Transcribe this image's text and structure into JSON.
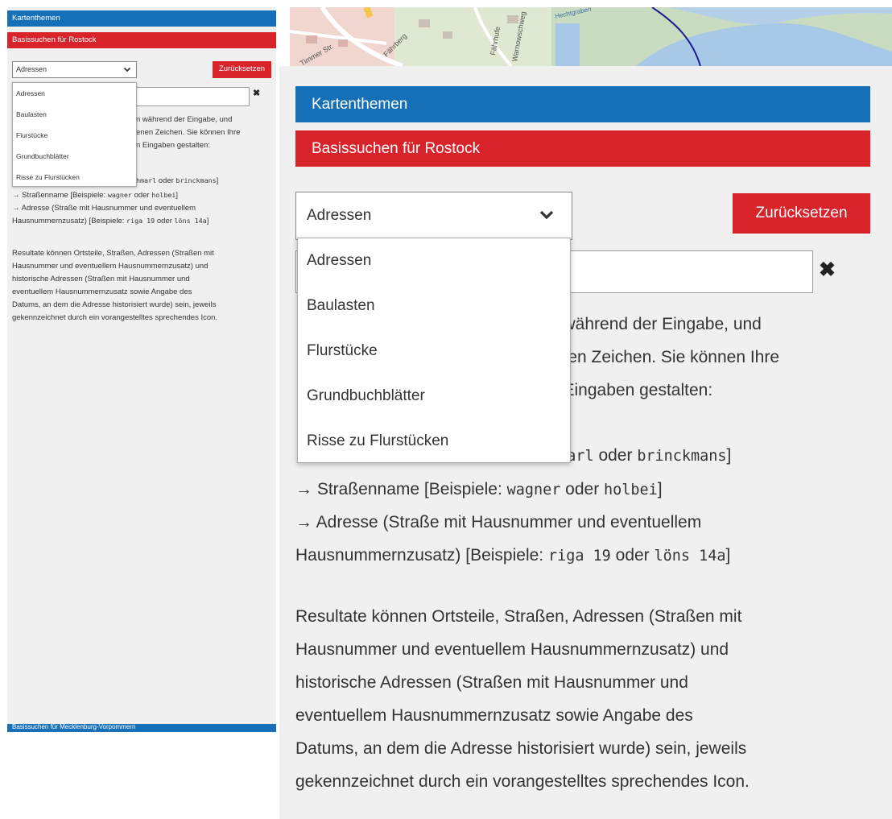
{
  "header": {
    "kartenthemen": "Kartenthemen",
    "basissuchen": "Basissuchen für Rostock",
    "mv": "Basissuchen für Mecklenburg-Vorpommern"
  },
  "select": {
    "value": "Adressen"
  },
  "reset_label": "Zurücksetzen",
  "dropdown": [
    "Adressen",
    "Baulasten",
    "Flurstücke",
    "Grundbuchblätter",
    "Risse zu Flurstücken"
  ],
  "small_text": {
    "l1": "n während der Eingabe, und",
    "l2": "enen Zeichen. Sie können Ihre",
    "l3": "n Eingaben gestalten:",
    "l4_code1": "hmarl",
    "l4_or": " oder ",
    "l4_code2": "brinckmans",
    "l4_end": "]",
    "l5_pre": "→ Straßenname [Beispiele: ",
    "l5_code1": "wagner",
    "l5_or": " oder ",
    "l5_code2": "holbei",
    "l5_end": "]",
    "l6": "→ Adresse (Straße mit Hausnummer und eventuellem",
    "l7_pre": "Hausnummernzusatz) [Beispiele: ",
    "l7_code1": "riga 19",
    "l7_or": " oder ",
    "l7_code2": "löns 14a",
    "l7_end": "]",
    "p1": "Resultate können Ortsteile, Straßen, Adressen (Straßen mit",
    "p2": "Hausnummer und eventuellem Hausnummernzusatz) und",
    "p3": "historische Adressen (Straßen mit Hausnummer und",
    "p4": "eventuellem Hausnummernzusatz sowie Angabe des",
    "p5": "Datums, an dem die Adresse historisiert wurde) sein, jeweils",
    "p6": "gekennzeichnet durch ein vorangestelltes sprechendes Icon."
  },
  "big_text": {
    "l1": "n während der Eingabe, und",
    "l2": "enen Zeichen. Sie können Ihre",
    "l3": "n Eingaben gestalten:",
    "l4_code1": "hmarl",
    "l4_or": " oder ",
    "l4_code2": "brinckmans",
    "l4_end": "]",
    "l5_pre": "→ Straßenname [Beispiele: ",
    "l5_code1": "wagner",
    "l5_or": " oder ",
    "l5_code2": "holbei",
    "l5_end": "]",
    "l6": "→ Adresse (Straße mit Hausnummer und eventuellem",
    "l7_pre": "Hausnummernzusatz) [Beispiele: ",
    "l7_code1": "riga 19",
    "l7_or": " oder ",
    "l7_code2": "löns 14a",
    "l7_end": "]",
    "p1": "Resultate können Ortsteile, Straßen, Adressen (Straßen mit",
    "p2": "Hausnummer und eventuellem Hausnummernzusatz) und",
    "p3": "historische Adressen (Straßen mit Hausnummer und",
    "p4": "eventuellem Hausnummernzusatz sowie Angabe des",
    "p5": "Datums, an dem die Adresse historisiert wurde) sein, jeweils",
    "p6": "gekennzeichnet durch ein vorangestelltes sprechendes Icon."
  },
  "map": {
    "streets": [
      "Fährberg",
      "Fährhufe",
      "Hechtgraben",
      "Warnowschweg",
      "Timmer Str."
    ]
  },
  "colors": {
    "blue": "#1570b8",
    "red": "#d9232b",
    "panel_bg": "#f0f0f0"
  }
}
